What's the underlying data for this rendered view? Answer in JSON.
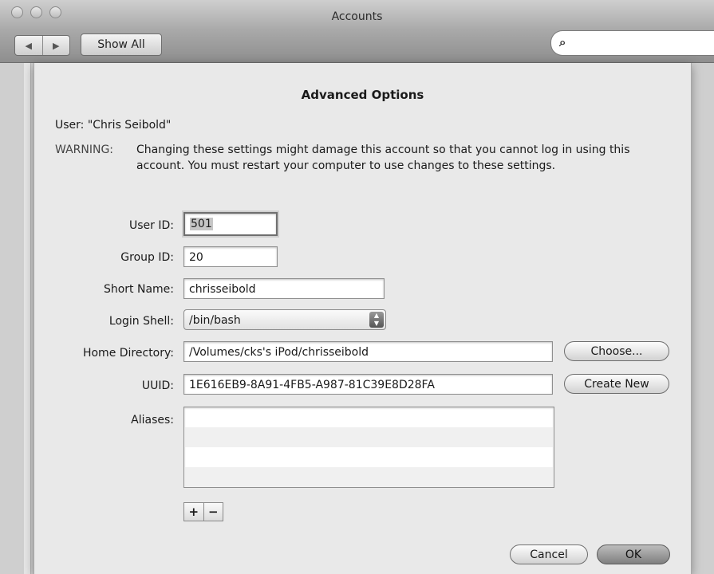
{
  "window": {
    "title": "Accounts",
    "nav_back": "◀",
    "nav_forward": "▶",
    "show_all": "Show All",
    "search_placeholder": ""
  },
  "sheet": {
    "title": "Advanced Options",
    "user_line": "User: \"Chris Seibold\"",
    "warning_label": "WARNING:",
    "warning_text": "Changing these settings might damage this account so that you cannot log in using this account. You must restart your computer to use changes to these settings.",
    "fields": {
      "user_id": {
        "label": "User ID:",
        "value": "501"
      },
      "group_id": {
        "label": "Group ID:",
        "value": "20"
      },
      "short_name": {
        "label": "Short Name:",
        "value": "chrisseibold"
      },
      "login_shell": {
        "label": "Login Shell:",
        "value": "/bin/bash"
      },
      "home_directory": {
        "label": "Home Directory:",
        "value": "/Volumes/cks's iPod/chrisseibold"
      },
      "uuid": {
        "label": "UUID:",
        "value": "1E616EB9-8A91-4FB5-A987-81C39E8D28FA"
      },
      "aliases": {
        "label": "Aliases:"
      }
    },
    "buttons": {
      "choose": "Choose...",
      "create_new": "Create New",
      "add": "+",
      "remove": "−",
      "cancel": "Cancel",
      "ok": "OK"
    }
  }
}
